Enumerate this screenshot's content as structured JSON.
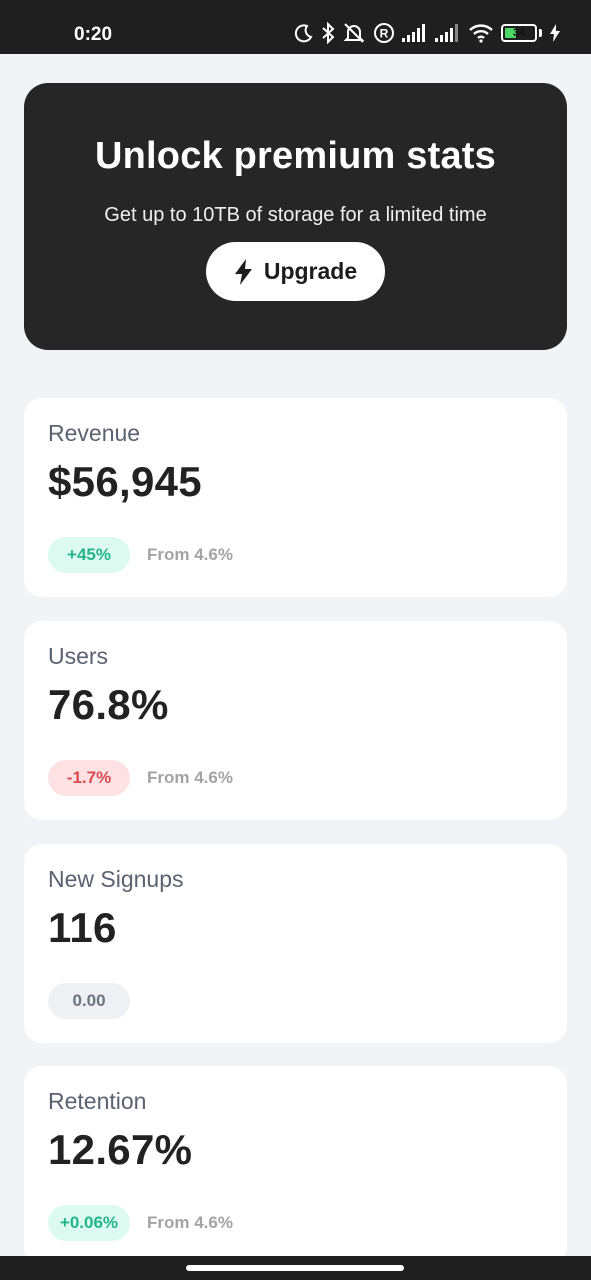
{
  "status_bar": {
    "time": "0:20",
    "battery_level": "34",
    "battery_fraction": 0.34,
    "icons": [
      "moon-icon",
      "bluetooth-icon",
      "bell-off-icon",
      "registered-icon",
      "signal-icon",
      "signal-icon",
      "wifi-icon",
      "battery-icon",
      "charging-icon"
    ]
  },
  "promo": {
    "title": "Unlock premium stats",
    "subtitle": "Get up to 10TB of storage for a limited time",
    "button_label": "Upgrade",
    "button_icon": "lightning-bolt-icon"
  },
  "stats": [
    {
      "label": "Revenue",
      "value": "$56,945",
      "change": "+45%",
      "trend": "positive",
      "from": "From 4.6%"
    },
    {
      "label": "Users",
      "value": "76.8%",
      "change": "-1.7%",
      "trend": "negative",
      "from": "From 4.6%"
    },
    {
      "label": "New Signups",
      "value": "116",
      "change": "0.00",
      "trend": "neutral",
      "from": ""
    },
    {
      "label": "Retention",
      "value": "12.67%",
      "change": "+0.06%",
      "trend": "positive",
      "from": "From 4.6%"
    }
  ],
  "colors": {
    "status_bar_bg": "#1f1f1f",
    "page_bg": "#f2f3f7",
    "promo_bg": "#262626",
    "card_bg": "#ffffff",
    "positive_bg": "#ddfaf1",
    "positive_text": "#23b58a",
    "negative_bg": "#fde1e3",
    "negative_text": "#d84a55",
    "neutral_bg": "#eef0f4",
    "neutral_text": "#6b7280"
  }
}
